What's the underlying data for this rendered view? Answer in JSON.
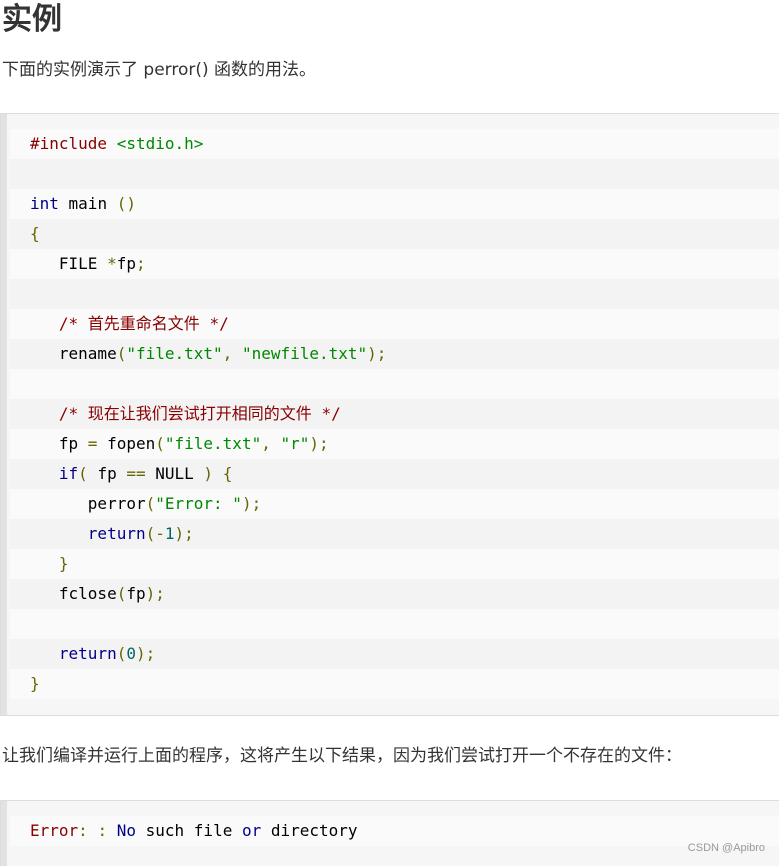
{
  "heading": "实例",
  "intro_text": "下面的实例演示了 perror() 函数的用法。",
  "code_lines": [
    [
      [
        "c-pre",
        "#include "
      ],
      [
        "c-inc",
        "<stdio.h>"
      ]
    ],
    [],
    [
      [
        "c-kw",
        "int"
      ],
      [
        "c-pln",
        " main "
      ],
      [
        "c-pun",
        "()"
      ]
    ],
    [
      [
        "c-pun",
        "{"
      ]
    ],
    [
      [
        "c-pln",
        "   FILE "
      ],
      [
        "c-pun",
        "*"
      ],
      [
        "c-pln",
        "fp"
      ],
      [
        "c-pun",
        ";"
      ]
    ],
    [],
    [
      [
        "c-pln",
        "   "
      ],
      [
        "c-com",
        "/* 首先重命名文件 */"
      ]
    ],
    [
      [
        "c-pln",
        "   rename"
      ],
      [
        "c-pun",
        "("
      ],
      [
        "c-str",
        "\"file.txt\""
      ],
      [
        "c-pun",
        ", "
      ],
      [
        "c-str",
        "\"newfile.txt\""
      ],
      [
        "c-pun",
        ");"
      ]
    ],
    [],
    [
      [
        "c-pln",
        "   "
      ],
      [
        "c-com",
        "/* 现在让我们尝试打开相同的文件 */"
      ]
    ],
    [
      [
        "c-pln",
        "   fp "
      ],
      [
        "c-pun",
        "="
      ],
      [
        "c-pln",
        " fopen"
      ],
      [
        "c-pun",
        "("
      ],
      [
        "c-str",
        "\"file.txt\""
      ],
      [
        "c-pun",
        ", "
      ],
      [
        "c-str",
        "\"r\""
      ],
      [
        "c-pun",
        ");"
      ]
    ],
    [
      [
        "c-pln",
        "   "
      ],
      [
        "c-kw",
        "if"
      ],
      [
        "c-pun",
        "("
      ],
      [
        "c-pln",
        " fp "
      ],
      [
        "c-pun",
        "=="
      ],
      [
        "c-pln",
        " NULL "
      ],
      [
        "c-pun",
        ")"
      ],
      [
        "c-pln",
        " "
      ],
      [
        "c-pun",
        "{"
      ]
    ],
    [
      [
        "c-pln",
        "      perror"
      ],
      [
        "c-pun",
        "("
      ],
      [
        "c-str",
        "\"Error: \""
      ],
      [
        "c-pun",
        ");"
      ]
    ],
    [
      [
        "c-pln",
        "      "
      ],
      [
        "c-kw",
        "return"
      ],
      [
        "c-pun",
        "(-"
      ],
      [
        "c-lit",
        "1"
      ],
      [
        "c-pun",
        ");"
      ]
    ],
    [
      [
        "c-pln",
        "   "
      ],
      [
        "c-pun",
        "}"
      ]
    ],
    [
      [
        "c-pln",
        "   fclose"
      ],
      [
        "c-pun",
        "("
      ],
      [
        "c-pln",
        "fp"
      ],
      [
        "c-pun",
        ");"
      ]
    ],
    [],
    [
      [
        "c-pln",
        "   "
      ],
      [
        "c-kw",
        "return"
      ],
      [
        "c-pun",
        "("
      ],
      [
        "c-lit",
        "0"
      ],
      [
        "c-pun",
        ");"
      ]
    ],
    [
      [
        "c-pun",
        "}"
      ]
    ]
  ],
  "outro_text": "让我们编译并运行上面的程序，这将产生以下结果，因为我们尝试打开一个不存在的文件：",
  "output_lines": [
    [
      [
        "c-pre",
        "Error"
      ],
      [
        "c-pun",
        ":"
      ],
      [
        "c-pln",
        " "
      ],
      [
        "c-pun",
        ":"
      ],
      [
        "c-pln",
        " "
      ],
      [
        "c-kw",
        "No"
      ],
      [
        "c-pln",
        " such file "
      ],
      [
        "c-kw",
        "or"
      ],
      [
        "c-pln",
        " directory"
      ]
    ]
  ],
  "watermark": "CSDN @Apibro",
  "colors": {
    "preprocessor": "#880000",
    "string": "#008800",
    "keyword": "#000088",
    "punctuation": "#666600",
    "literal": "#006666",
    "comment": "#880000"
  }
}
